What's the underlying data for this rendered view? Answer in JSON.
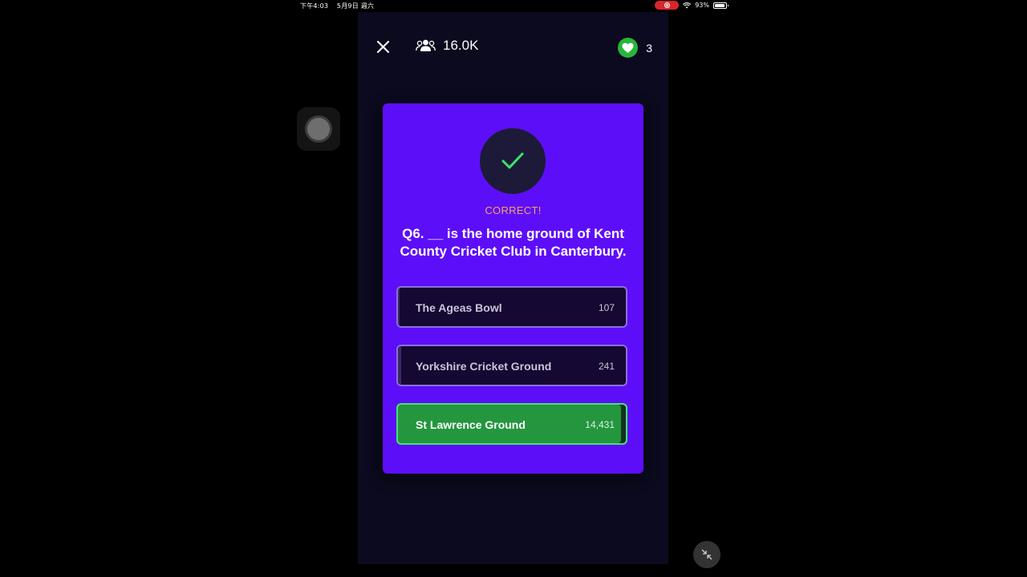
{
  "status_bar": {
    "time": "下午4:03",
    "date": "5月9日 週六",
    "battery": "93%"
  },
  "header": {
    "viewer_count": "16.0K",
    "lives": "3",
    "icons": [
      "close-icon",
      "users-icon",
      "heart-icon"
    ]
  },
  "card": {
    "result": "CORRECT!",
    "question": "Q6. __ is the home ground of Kent County Cricket Club in Canterbury.",
    "answers": [
      {
        "label": "The Ageas Bowl",
        "count": "107",
        "selected": false
      },
      {
        "label": "Yorkshire Cricket Ground",
        "count": "241",
        "selected": false
      },
      {
        "label": "St Lawrence Ground",
        "count": "14,431",
        "selected": true
      }
    ]
  },
  "colors": {
    "card_bg": "#5d0ef8",
    "correct_green": "#24963e",
    "result_text": "#f6a35c",
    "app_bg": "#0b0a1e"
  }
}
